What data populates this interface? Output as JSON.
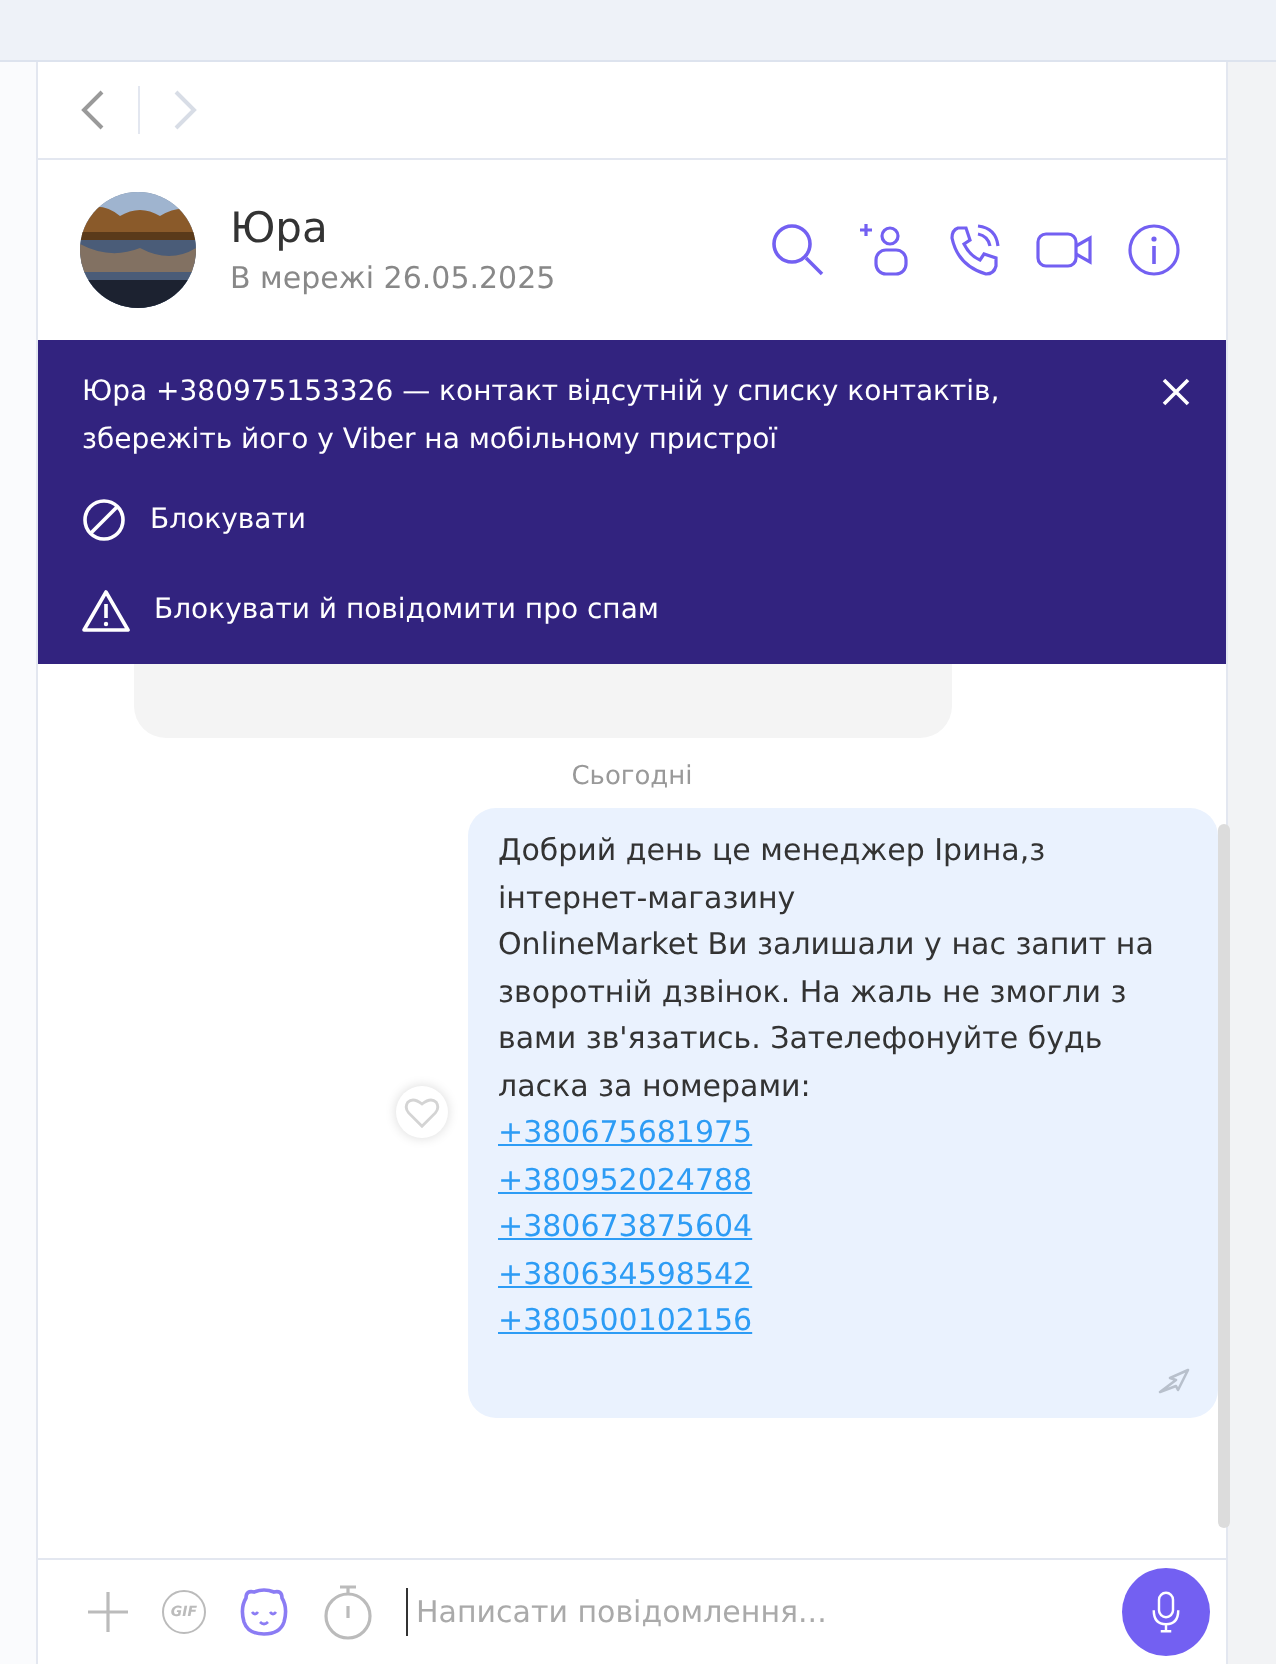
{
  "contact": {
    "name": "Юра",
    "status": "В мережі 26.05.2025"
  },
  "banner": {
    "text": "Юра +380975153326 — контакт відсутній у списку контактів, збережіть його у Viber на мобільному пристрої",
    "actions": [
      {
        "kind": "block",
        "label": "Блокувати"
      },
      {
        "kind": "report",
        "label": "Блокувати й повідомити про спам"
      }
    ]
  },
  "date_divider": "Сьогодні",
  "message": {
    "text": "Добрий день це менеджер Ірина,з інтернет-магазину\nOnlineMarket Ви залишали у нас запит на зворотній дзвінок. На жаль не змогли з вами зв'язатись. Зателефонуйте будь ласка за номерами:",
    "links": [
      "+380675681975",
      "+380952024788",
      "+380673875604",
      "+380634598542",
      "+380500102156"
    ]
  },
  "composer": {
    "gif_label": "GIF",
    "placeholder": "Написати повідомлення..."
  }
}
